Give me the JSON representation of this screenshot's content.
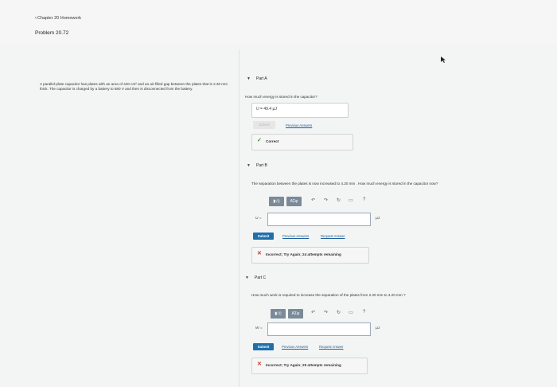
{
  "header": {
    "back_label": "Chapter 20 Homework",
    "problem_title": "Problem 20.72"
  },
  "problem": {
    "statement": "A parallel-plate capacitor has plates with an area of 440 cm² and an air-filled gap between the plates that is 2.30 mm thick. The capacitor is charged by a battery to 580 V and then is disconnected from the battery."
  },
  "part_a": {
    "label": "Part A",
    "question": "How much energy is stored in the capacitor?",
    "answer_var": "U =",
    "answer_value": "49.4",
    "answer_unit": "μJ",
    "submit_label": "Submit",
    "previous_answers_label": "Previous Answers",
    "feedback": "Correct"
  },
  "part_b": {
    "label": "Part B",
    "question": "The separation between the plates is now increased to 4.20 mm . How much energy is stored in the capacitor now?",
    "toolbar_templates_label": "▮√▯",
    "toolbar_symbols_label": "AΣφ",
    "var_label": "U =",
    "unit": "μJ",
    "submit_label": "Submit",
    "previous_answers_label": "Previous Answers",
    "request_answer_label": "Request Answer",
    "feedback": "Incorrect; Try Again; 24 attempts remaining"
  },
  "part_c": {
    "label": "Part C",
    "question": "How much work is required to increase the separation of the plates from 2.30 mm to 4.20 mm ?",
    "toolbar_templates_label": "▮√▯",
    "toolbar_symbols_label": "AΣφ",
    "var_label": "W =",
    "unit": "μJ",
    "submit_label": "Submit",
    "previous_answers_label": "Previous Answers",
    "request_answer_label": "Request Answer",
    "feedback": "Incorrect; Try Again; 25 attempts remaining"
  },
  "colors": {
    "submit_blue": "#1f6fab",
    "correct_green": "#3a8a2a",
    "incorrect_red": "#c0392b",
    "toolbar_gray": "#7b8a99"
  }
}
